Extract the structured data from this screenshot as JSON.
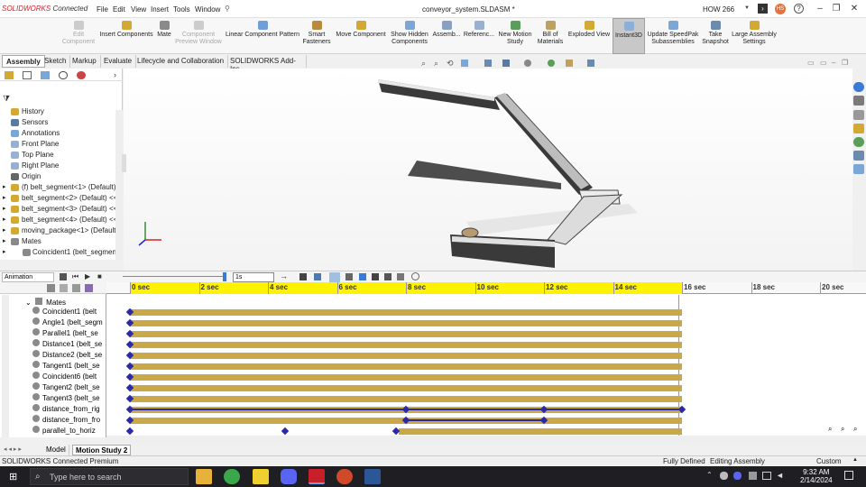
{
  "titlebar": {
    "logo_brand": "SOLIDWORKS",
    "logo_suffix": " Connected",
    "menus": [
      "File",
      "Edit",
      "View",
      "Insert",
      "Tools",
      "Window"
    ],
    "doc_title": "conveyor_system.SLDASM *",
    "search_value": "HOW 266",
    "avatar_initials": "HS"
  },
  "commands": [
    {
      "label": "Edit Component",
      "disabled": true
    },
    {
      "label": "Insert Components"
    },
    {
      "label": "Mate"
    },
    {
      "label": "Component Preview Window",
      "disabled": true
    },
    {
      "label": "Linear Component Pattern"
    },
    {
      "label": "Smart Fasteners"
    },
    {
      "label": "Move Component"
    },
    {
      "label": "Show Hidden Components"
    },
    {
      "label": "Assemb..."
    },
    {
      "label": "Referenc..."
    },
    {
      "label": "New Motion Study"
    },
    {
      "label": "Bill of Materials"
    },
    {
      "label": "Exploded View"
    },
    {
      "label": "Instant3D",
      "active": true
    },
    {
      "label": "Update SpeedPak Subassemblies"
    },
    {
      "label": "Take Snapshot"
    },
    {
      "label": "Large Assembly Settings"
    }
  ],
  "tabs": [
    "Assembly",
    "Sketch",
    "Markup",
    "Evaluate",
    "Lifecycle and Collaboration",
    "SOLIDWORKS Add-Ins"
  ],
  "tree_items": [
    {
      "label": "History",
      "icon": "folder"
    },
    {
      "label": "Sensors",
      "icon": "sensor"
    },
    {
      "label": "Annotations",
      "icon": "annotation"
    },
    {
      "label": "Front Plane",
      "icon": "plane"
    },
    {
      "label": "Top Plane",
      "icon": "plane"
    },
    {
      "label": "Right Plane",
      "icon": "plane"
    },
    {
      "label": "Origin",
      "icon": "origin"
    },
    {
      "label": "(f) belt_segment<1> (Default)",
      "icon": "part"
    },
    {
      "label": "belt_segment<2> (Default) <<",
      "icon": "part"
    },
    {
      "label": "belt_segment<3> (Default) <<",
      "icon": "part"
    },
    {
      "label": "belt_segment<4> (Default) <<",
      "icon": "part"
    },
    {
      "label": "moving_package<1> (Default)",
      "icon": "part"
    },
    {
      "label": "Mates",
      "icon": "mates"
    },
    {
      "label": "Coincident1 (belt_segment-",
      "icon": "mate"
    }
  ],
  "motion": {
    "study_type": "Animation",
    "time_field": "1s",
    "mates_label": "Mates",
    "rows": [
      {
        "label": "Coincident1 (belt"
      },
      {
        "label": "Angle1 (belt_segm"
      },
      {
        "label": "Parallel1 (belt_se"
      },
      {
        "label": "Distance1 (belt_se"
      },
      {
        "label": "Distance2 (belt_se"
      },
      {
        "label": "Tangent1 (belt_se"
      },
      {
        "label": "Coincident6 (belt"
      },
      {
        "label": "Tangent2 (belt_se"
      },
      {
        "label": "Tangent3 (belt_se"
      },
      {
        "label": "distance_from_rig"
      },
      {
        "label": "distance_from_fro"
      },
      {
        "label": "parallel_to_horiz"
      }
    ],
    "ticks": [
      "0 sec",
      "2 sec",
      "4 sec",
      "6 sec",
      "8 sec",
      "10 sec",
      "12 sec",
      "14 sec",
      "16 sec",
      "18 sec",
      "20 sec"
    ]
  },
  "bottom_tabs": [
    "Model",
    "Motion Study 2"
  ],
  "status": {
    "left": "SOLIDWORKS Connected Premium",
    "defined": "Fully Defined",
    "mode": "Editing Assembly",
    "units": "Custom"
  },
  "taskbar": {
    "search_placeholder": "Type here to search",
    "time": "9:32 AM",
    "date": "2/14/2024"
  },
  "colors": {
    "brand": "#d2232a",
    "track": "#c8a848",
    "keyframe": "#2a2aa8",
    "time_highlight": "#fff200"
  }
}
